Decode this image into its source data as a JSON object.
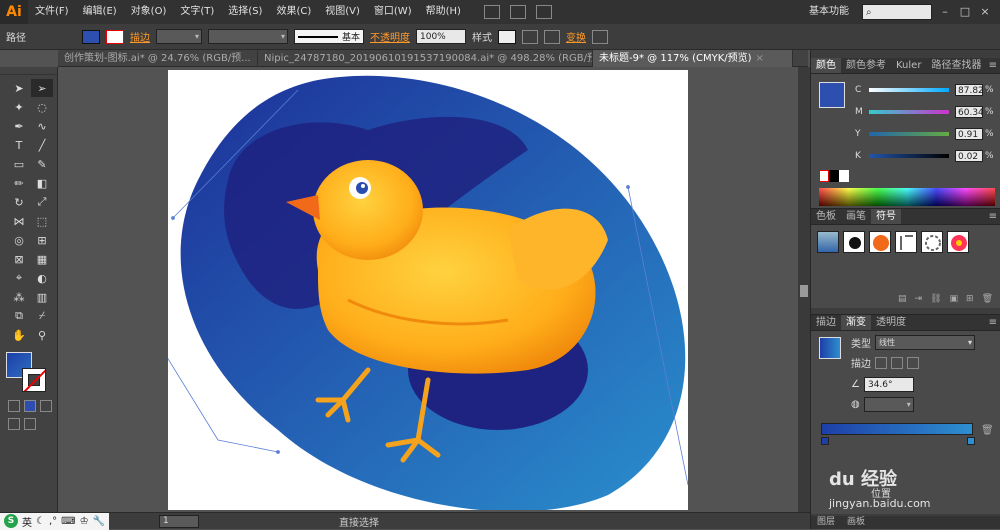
{
  "app": {
    "logo": "Ai",
    "workspace": "基本功能"
  },
  "menu": [
    "文件(F)",
    "编辑(E)",
    "对象(O)",
    "文字(T)",
    "选择(S)",
    "效果(C)",
    "视图(V)",
    "窗口(W)",
    "帮助(H)"
  ],
  "control_bar": {
    "selection_label": "路径",
    "stroke_label": "描边",
    "stroke_style": "基本",
    "opacity_label": "不透明度",
    "opacity_value": "100%",
    "style_label": "样式",
    "transform_label": "变换"
  },
  "tabs": [
    {
      "label": "创作策划-图标.ai* @ 24.76% (RGB/预...",
      "active": false
    },
    {
      "label": "Nipic_24787180_20190610191537190084.ai* @ 498.28% (RGB/预...",
      "active": false
    },
    {
      "label": "未标题-9* @ 117% (CMYK/预览)",
      "active": true
    }
  ],
  "tools": [
    "selection",
    "direct-selection",
    "magic-wand",
    "lasso",
    "pen",
    "curvature",
    "type",
    "line",
    "rectangle",
    "paintbrush",
    "pencil",
    "eraser",
    "rotate",
    "scale",
    "width",
    "free-transform",
    "shape-builder",
    "perspective",
    "mesh",
    "gradient",
    "eyedropper",
    "blend",
    "symbol-sprayer",
    "column-graph",
    "artboard",
    "slice",
    "hand",
    "zoom"
  ],
  "color_panel": {
    "tabs": [
      "颜色",
      "颜色参考",
      "Kuler",
      "路径查找器"
    ],
    "channels": [
      {
        "key": "C",
        "value": "87.82",
        "fraction": 0.88
      },
      {
        "key": "M",
        "value": "60.34",
        "fraction": 0.6
      },
      {
        "key": "Y",
        "value": "0.91",
        "fraction": 0.01
      },
      {
        "key": "K",
        "value": "0.02",
        "fraction": 0.0
      }
    ],
    "fill_color": "#2c4fb0"
  },
  "symbol_panel": {
    "tabs": [
      "色板",
      "画笔",
      "符号"
    ]
  },
  "gradient_panel": {
    "tabs": [
      "描边",
      "渐变",
      "透明度"
    ],
    "type_label": "类型",
    "type_value": "线性",
    "stroke_label": "描边",
    "angle_value": "34.6°",
    "position_label": "位置",
    "watermark": "du 经验",
    "watermark_sub": "jingyan.baidu.com",
    "colors": [
      "#1e3fa8",
      "#2d8fd0"
    ]
  },
  "bottom_tabs": [
    "图层",
    "画板"
  ],
  "status": {
    "page": "1",
    "tool": "直接选择"
  },
  "ime": {
    "label": "英"
  }
}
